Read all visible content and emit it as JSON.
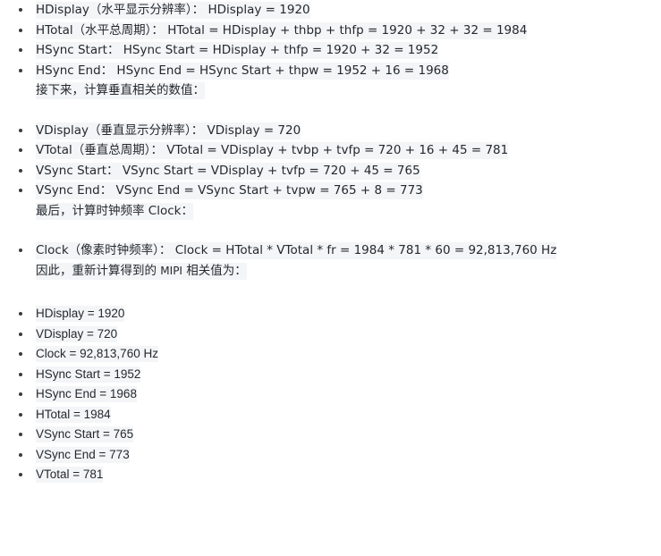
{
  "document": {
    "theme": {
      "text_color": "#24292e",
      "highlight_color": "#f4f5f7",
      "background_color": "#ffffff",
      "bullet_color": "#3b3b3b"
    },
    "horizontal_section": {
      "items": [
        "HDisplay（水平显示分辨率）： HDisplay = 1920",
        "HTotal（水平总周期）： HTotal = HDisplay + thbp + thfp = 1920 + 32 + 32 = 1984",
        "HSync Start： HSync Start = HDisplay + thfp = 1920 + 32 = 1952",
        "HSync End： HSync End = HSync Start + thpw = 1952 + 16 = 1968"
      ],
      "closing_paragraph": "接下来，计算垂直相关的数值："
    },
    "vertical_section": {
      "items": [
        "VDisplay（垂直显示分辨率）： VDisplay = 720",
        "VTotal（垂直总周期）： VTotal = VDisplay + tvbp + tvfp = 720 + 16 + 45 = 781",
        "VSync Start： VSync Start = VDisplay + tvfp = 720 + 45 = 765",
        "VSync End： VSync End = VSync Start + tvpw = 765 + 8 = 773"
      ],
      "closing_paragraph": "最后，计算时钟频率 Clock："
    },
    "clock_section": {
      "items": [
        "Clock（像素时钟频率）： Clock = HTotal * VTotal * fr = 1984 * 781 * 60 = 92,813,760 Hz"
      ],
      "closing_paragraph_prefix": "因此，重新计算得到的 ",
      "closing_paragraph_latin": "MIPI",
      "closing_paragraph_suffix": " 相关值为："
    },
    "summary_section": {
      "items": [
        "HDisplay = 1920",
        "VDisplay = 720",
        "Clock = 92,813,760 Hz",
        "HSync Start = 1952",
        "HSync End = 1968",
        "HTotal = 1984",
        "VSync Start = 765",
        "VSync End = 773",
        "VTotal = 781"
      ]
    }
  }
}
